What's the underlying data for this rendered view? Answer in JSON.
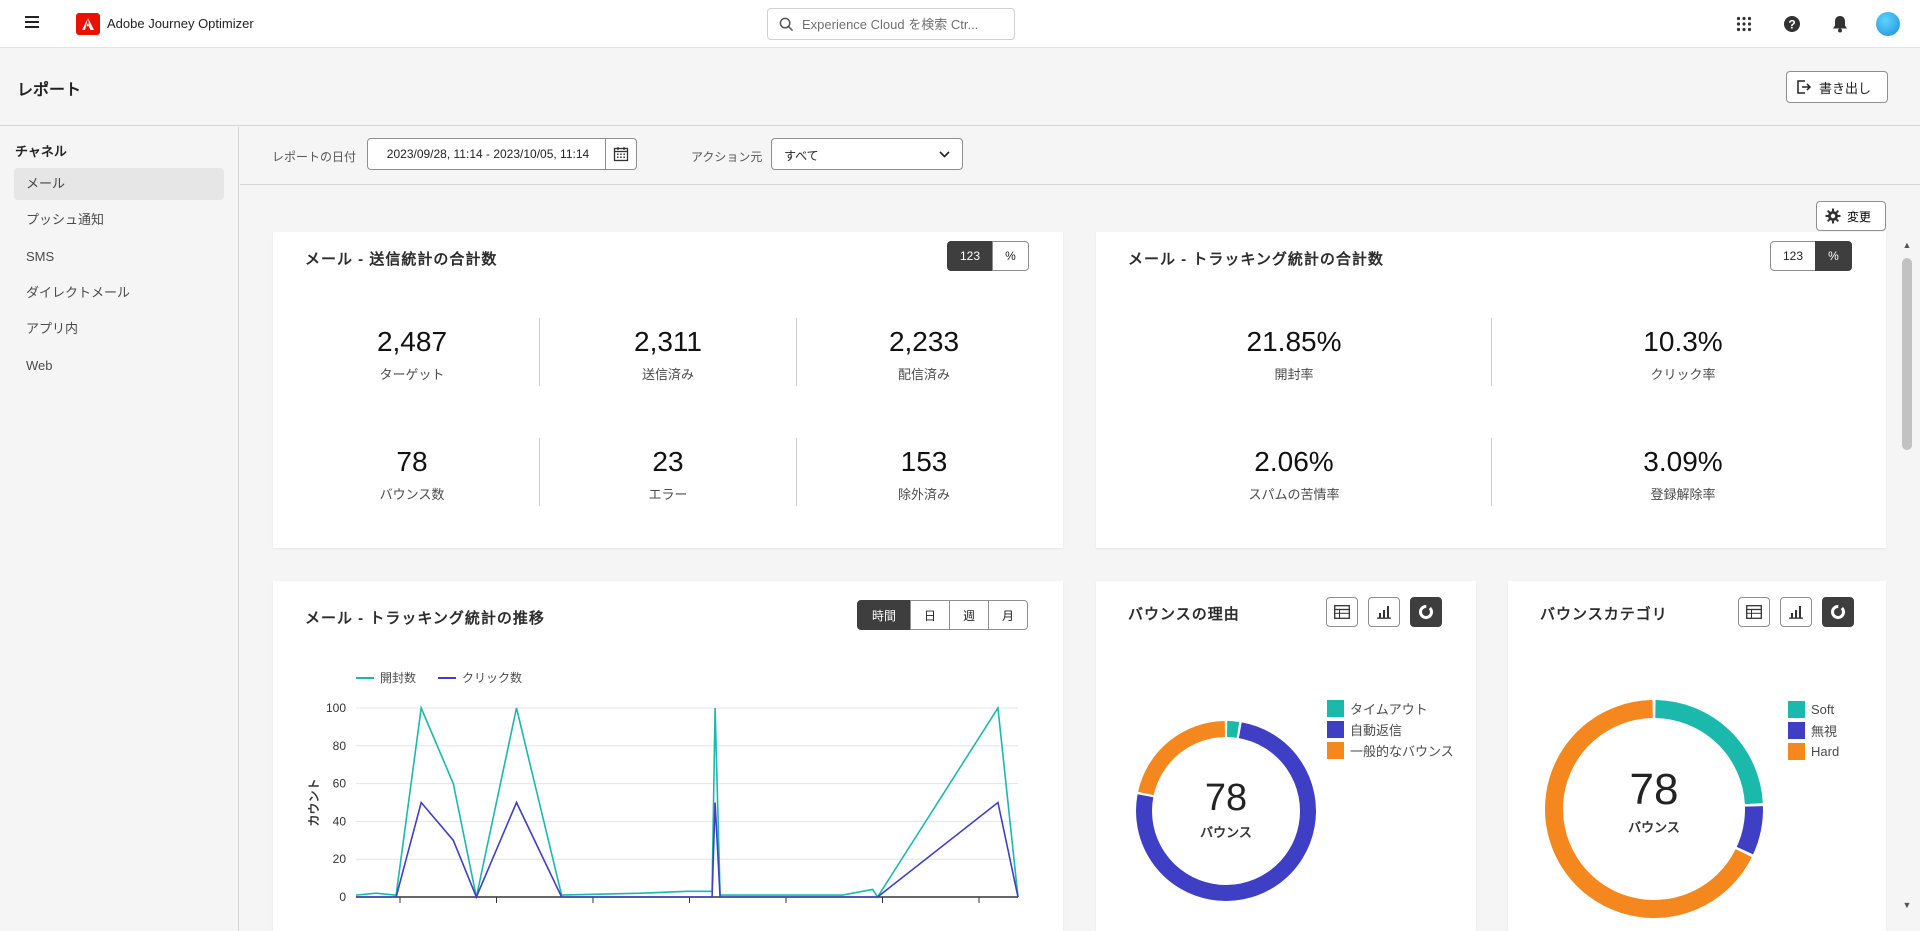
{
  "topbar": {
    "app_title": "Adobe Journey Optimizer",
    "search_placeholder": "Experience Cloud を検索 Ctr..."
  },
  "header": {
    "title": "レポート",
    "export_label": "書き出し"
  },
  "sidebar": {
    "heading": "チャネル",
    "items": [
      {
        "label": "メール",
        "active": true
      },
      {
        "label": "プッシュ通知"
      },
      {
        "label": "SMS"
      },
      {
        "label": "ダイレクトメール"
      },
      {
        "label": "アプリ内"
      },
      {
        "label": "Web"
      }
    ]
  },
  "filters": {
    "date_label": "レポートの日付",
    "date_range": "2023/09/28, 11:14  -  2023/10/05, 11:14",
    "action_label": "アクション元",
    "action_value": "すべて"
  },
  "change_label": "変更",
  "send_stats": {
    "title": "メール - 送信統計の合計数",
    "toggle": [
      "123",
      "%"
    ],
    "stats": [
      {
        "value": "2,487",
        "label": "ターゲット"
      },
      {
        "value": "2,311",
        "label": "送信済み"
      },
      {
        "value": "2,233",
        "label": "配信済み"
      },
      {
        "value": "78",
        "label": "バウンス数"
      },
      {
        "value": "23",
        "label": "エラー"
      },
      {
        "value": "153",
        "label": "除外済み"
      }
    ]
  },
  "tracking_stats": {
    "title": "メール - トラッキング統計の合計数",
    "toggle": [
      "123",
      "%"
    ],
    "stats": [
      {
        "value": "21.85%",
        "label": "開封率"
      },
      {
        "value": "10.3%",
        "label": "クリック率"
      },
      {
        "value": "2.06%",
        "label": "スパムの苦情率"
      },
      {
        "value": "3.09%",
        "label": "登録解除率"
      }
    ]
  },
  "trend": {
    "title": "メール - トラッキング統計の推移",
    "periods": [
      "時間",
      "日",
      "週",
      "月"
    ]
  },
  "bounce_reason": {
    "title": "バウンスの理由",
    "center_value": "78",
    "center_label": "バウンス",
    "legend": [
      {
        "label": "タイムアウト",
        "color": "#1bb8ac"
      },
      {
        "label": "自動返信",
        "color": "#3f3fc6"
      },
      {
        "label": "一般的なバウンス",
        "color": "#f5871f"
      }
    ]
  },
  "bounce_category": {
    "title": "バウンスカテゴリ",
    "center_value": "78",
    "center_label": "バウンス",
    "legend": [
      {
        "label": "Soft",
        "color": "#1bb8ac"
      },
      {
        "label": "無視",
        "color": "#3f3fc6"
      },
      {
        "label": "Hard",
        "color": "#f5871f"
      }
    ]
  },
  "chart_data": [
    {
      "type": "line",
      "ylabel": "カウント",
      "ylim": [
        0,
        100
      ],
      "yticks": [
        0,
        20,
        40,
        60,
        80,
        100
      ],
      "legend_position": "top-left",
      "grid": true,
      "series": [
        {
          "name": "開封数",
          "color": "#1bb8ac",
          "values": [
            1,
            2,
            1,
            100,
            60,
            0,
            100,
            1,
            2,
            3,
            3,
            100,
            1,
            1,
            1,
            1,
            2,
            4,
            0,
            100,
            0
          ]
        },
        {
          "name": "クリック数",
          "color": "#3f3fc6",
          "values": [
            0,
            0,
            0,
            50,
            30,
            0,
            50,
            0,
            0,
            0,
            0,
            50,
            0,
            0,
            0,
            0,
            0,
            0,
            0,
            50,
            0
          ]
        }
      ]
    },
    {
      "type": "pie",
      "title": "バウンスの理由",
      "categories": [
        "タイムアウト",
        "自動返信",
        "一般的なバウンス"
      ],
      "values": [
        2,
        59,
        17
      ]
    },
    {
      "type": "pie",
      "title": "バウンスカテゴリ",
      "categories": [
        "Soft",
        "無視",
        "Hard"
      ],
      "values": [
        19,
        6,
        53
      ]
    }
  ]
}
